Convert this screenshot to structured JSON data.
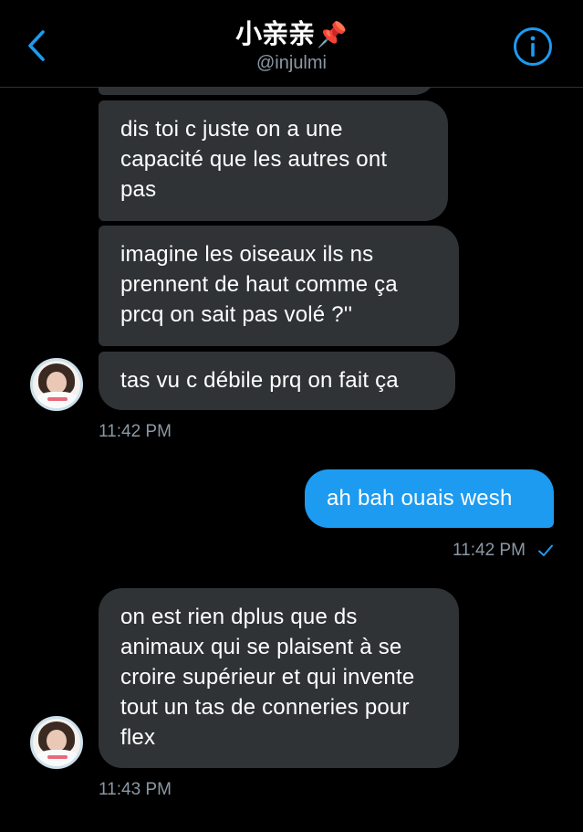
{
  "header": {
    "title": "小亲亲",
    "pin_emoji": "📌",
    "handle": "@injulmi",
    "back_icon": "chevron-left-icon",
    "info_icon": "info-icon"
  },
  "colors": {
    "accent": "#1d9bf0",
    "incoming_bubble": "#2f3336",
    "timestamp": "#8b98a5"
  },
  "messages": {
    "m1": "dis toi c juste on a une capacité que les autres ont pas",
    "m2": "imagine les oiseaux ils ns prennent de haut comme ça prcq on sait pas volé ?''",
    "m3": "tas vu c débile prq on fait ça",
    "m3_time": "11:42 PM",
    "m4": "ah bah ouais wesh",
    "m4_time": "11:42 PM",
    "m5": "on est rien dplus que ds animaux qui se plaisent à se croire supérieur et qui invente tout un tas de conneries pour flex",
    "m5_time": "11:43 PM"
  }
}
